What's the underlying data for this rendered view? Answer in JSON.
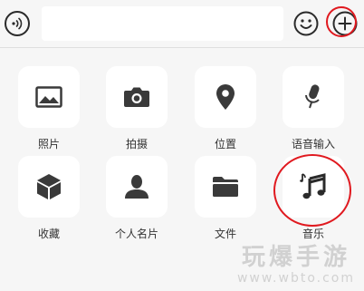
{
  "input_bar": {
    "voice_icon": "voice-wave-icon",
    "input_value": "",
    "emoji_icon": "smiley-face-icon",
    "plus_icon": "plus-circle-icon"
  },
  "panel": {
    "items": [
      {
        "label": "照片",
        "icon": "image-icon"
      },
      {
        "label": "拍摄",
        "icon": "camera-icon"
      },
      {
        "label": "位置",
        "icon": "location-pin-icon"
      },
      {
        "label": "语音输入",
        "icon": "microphone-icon"
      },
      {
        "label": "收藏",
        "icon": "cube-icon"
      },
      {
        "label": "个人名片",
        "icon": "person-icon"
      },
      {
        "label": "文件",
        "icon": "folder-icon"
      },
      {
        "label": "音乐",
        "icon": "music-note-icon"
      }
    ]
  },
  "annotation": {
    "color": "#e0191f"
  },
  "watermark": {
    "title": "玩爆手游",
    "url": "www.wbto.com"
  }
}
